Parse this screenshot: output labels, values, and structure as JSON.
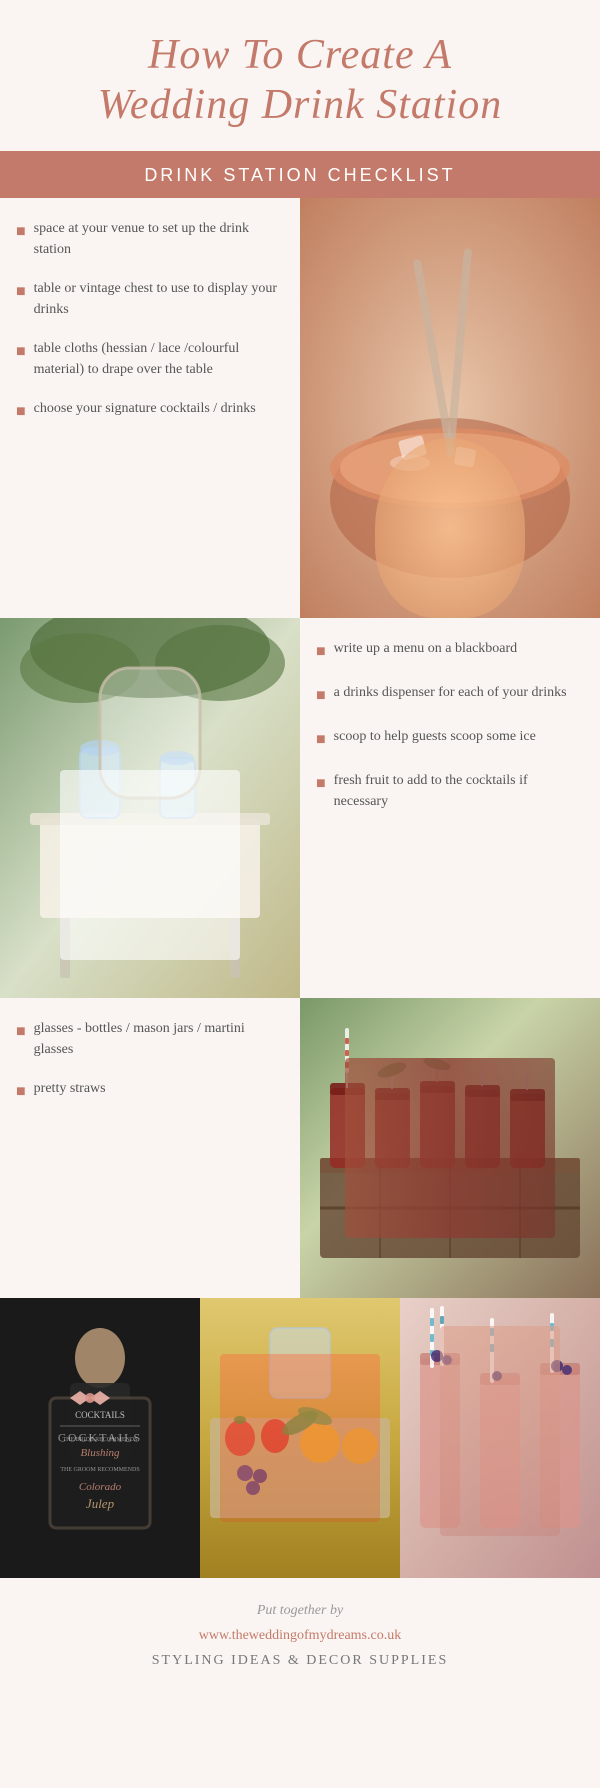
{
  "header": {
    "title_line1": "How To Create A",
    "title_line2": "Wedding Drink Station"
  },
  "checklist_header": "DRINK STATION CHECKLIST",
  "checklist_col1": [
    "space at your venue to set up the drink station",
    "table or vintage chest to use to display your drinks",
    "table cloths (hessian / lace /colourful material) to drape over the table",
    "choose your signature cocktails / drinks"
  ],
  "checklist_col2": [
    "write up a menu on a blackboard",
    "a drinks dispenser  for each of your drinks",
    "scoop to help guests scoop some ice",
    "fresh fruit to add to the cocktails if necessary"
  ],
  "checklist_col3": [
    "glasses - bottles / mason jars / martini glasses",
    "pretty straws"
  ],
  "footer": {
    "put_together": "Put together by",
    "url": "www.theweddingofmydreams.co.uk",
    "styling": "STYLING IDEAS & DECOR SUPPLIES"
  },
  "bullet": "■"
}
